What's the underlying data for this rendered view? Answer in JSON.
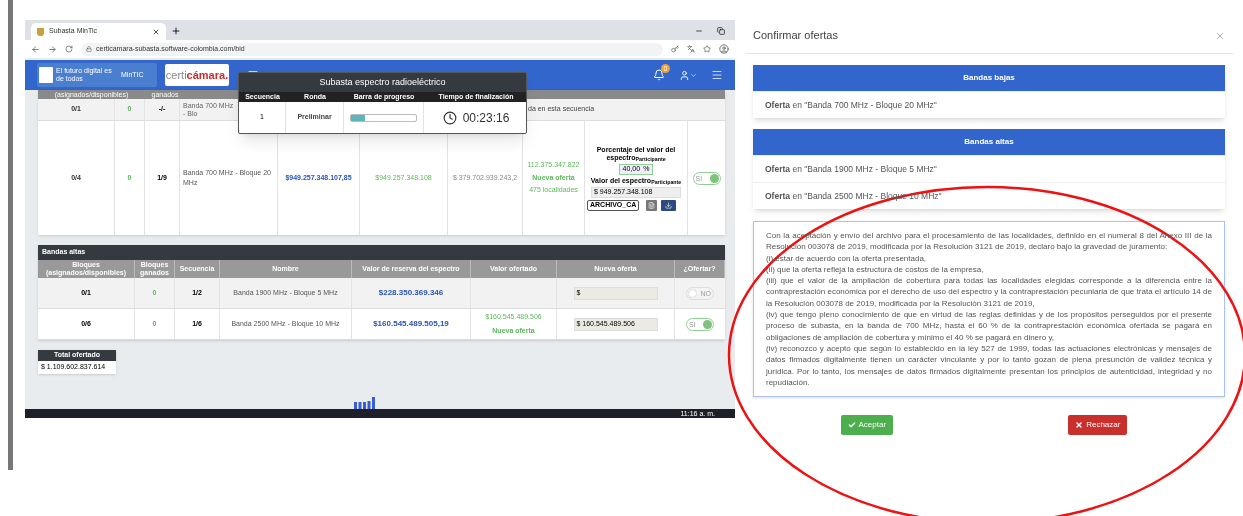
{
  "browser": {
    "tab_title": "Subasta MinTic",
    "address": "certicamara-subasta.software-colombia.com/bid"
  },
  "header": {
    "logo_text": "El futuro digital es de todos",
    "logo_badge": "MinTIC",
    "brand_first": "certi",
    "brand_second": "cámara.",
    "notification_count": "0"
  },
  "popup": {
    "title": "Subasta espectro radioeléctrico",
    "columns": [
      "Secuencia",
      "Ronda",
      "Barra de progreso",
      "Tiempo de finalización"
    ],
    "row": {
      "sequence": "1",
      "round": "Preliminar",
      "progress": {
        "level": 0.22
      },
      "time": "00:23:16"
    }
  },
  "bandas_bajas": {
    "header_fragments": [
      "(asignados/disponibles)",
      "ganados"
    ],
    "partial_row": {
      "blocks": "0/1",
      "won": "0",
      "sequence": "-/-",
      "name": "Banda 700 MHz - Blo",
      "message": "da en esta secuencia"
    },
    "row": {
      "blocks": "0/4",
      "won": "0",
      "sequence": "1/9",
      "name": "Banda 700 MHz - Bloque 20 MHz",
      "reserve": "$949.257.348.107,85",
      "offered": "$949.257.348.108",
      "column_7": "$ 379.702.939.243,2",
      "offer_value": "112.375.347.822",
      "offer_note": "Nueva oferta",
      "localities": "475 localidades",
      "percentage_label": "Porcentaje del valor del espectro$_{Participante}$",
      "percentage_value": "40,00",
      "percentage_unit": "%",
      "value_label": "Valor del espectro$_{Participante}$",
      "value_field": "$ 949.257.348.108",
      "file_button": "ARCHIVO_CA",
      "toggle": {
        "on": true,
        "label": "SI"
      }
    }
  },
  "bandas_altas": {
    "title": "Bandas altas",
    "columns": [
      "Bloques (asignados/disponibles)",
      "Bloques ganados",
      "Secuencia",
      "Nombre",
      "Valor de reserva del espectro",
      "Valor ofertado",
      "Nueva oferta",
      "¿Ofertar?"
    ],
    "rows": [
      {
        "blocks": "0/1",
        "won": "0",
        "sequence": "1/2",
        "name": "Banda 1900 MHz - Bloque 5 MHz",
        "reserve": "$228.350.369.346",
        "new_offer": "$",
        "toggle": {
          "on": false,
          "label": "NO"
        }
      },
      {
        "blocks": "0/6",
        "won": "0",
        "sequence": "1/6",
        "name": "Banda 2500 MHz - Bloque 10 MHz",
        "reserve": "$160.545.489.505,19",
        "offered": "$160.545.489.506",
        "offered_note": "Nueva oferta",
        "new_offer": "$ 160.545.489.506",
        "toggle": {
          "on": true,
          "label": "SI"
        }
      }
    ]
  },
  "total": {
    "label": "Total ofertado",
    "value": "$ 1.109.602.837.614"
  },
  "taskbar": {
    "time": "11:16 a. m."
  },
  "modal": {
    "title": "Confirmar ofertas",
    "sections": [
      {
        "title": "Bandas bajas",
        "items": [
          "**Oferta** en \"Banda 700 MHz - Bloque 20 MHz\""
        ]
      },
      {
        "title": "Bandas altas",
        "items": [
          "**Oferta** en \"Banda 1900 MHz - Bloque 5 MHz\"",
          "**Oferta** en \"Banda 2500 MHz - Bloque 10 MHz\""
        ]
      }
    ],
    "declaration": [
      "Con la aceptación y envío del archivo para el procesamiento de las localidades, definido en el numeral 8 del Anexo III de la Resolución 003078 de 2019, modificada por la Resolución 3121 de 2019, declaro bajo la gravedad de juramento:",
      "(i) estar de acuerdo con la oferta presentada,",
      "(ii) que la oferta refleja la estructura de costos de la empresa,",
      "(iii) que el valor de la ampliación de cobertura para todas las localidades elegidas corresponde a la diferencia entre la contraprestación económica por el derecho de uso del espectro y la contraprestación pecuniaria de que trata el artículo 14 de la Resolución 003078 de 2019, modificada por la Resolución 3121 de 2019,",
      "(iv) que tengo pleno conocimiento de que en virtud de las reglas definidas y de los propósitos perseguidos por el presente proceso de subasta, en la banda de 700 MHz, hasta el 60 % de la contraprestación económica ofertada se pagará en obligaciones de ampliación de cobertura y mínimo el 40 % se pagará en dinero y,",
      "(iv) reconozco y acepto que según lo establecido en la ley 527 de 1999, todas las actuaciones electrónicas y mensajes de datos firmados digitalmente tienen un carácter vinculante y por lo tanto gozan de plena presunción de validez técnica y jurídica. Por lo tanto, los mensajes de datos firmados digitalmente presentan los principios de autenticidad, integridad y no repudiación."
    ],
    "buttons": [
      {
        "label": "Aceptar",
        "kind": "accept"
      },
      {
        "label": "Rechazar",
        "kind": "reject"
      }
    ]
  }
}
